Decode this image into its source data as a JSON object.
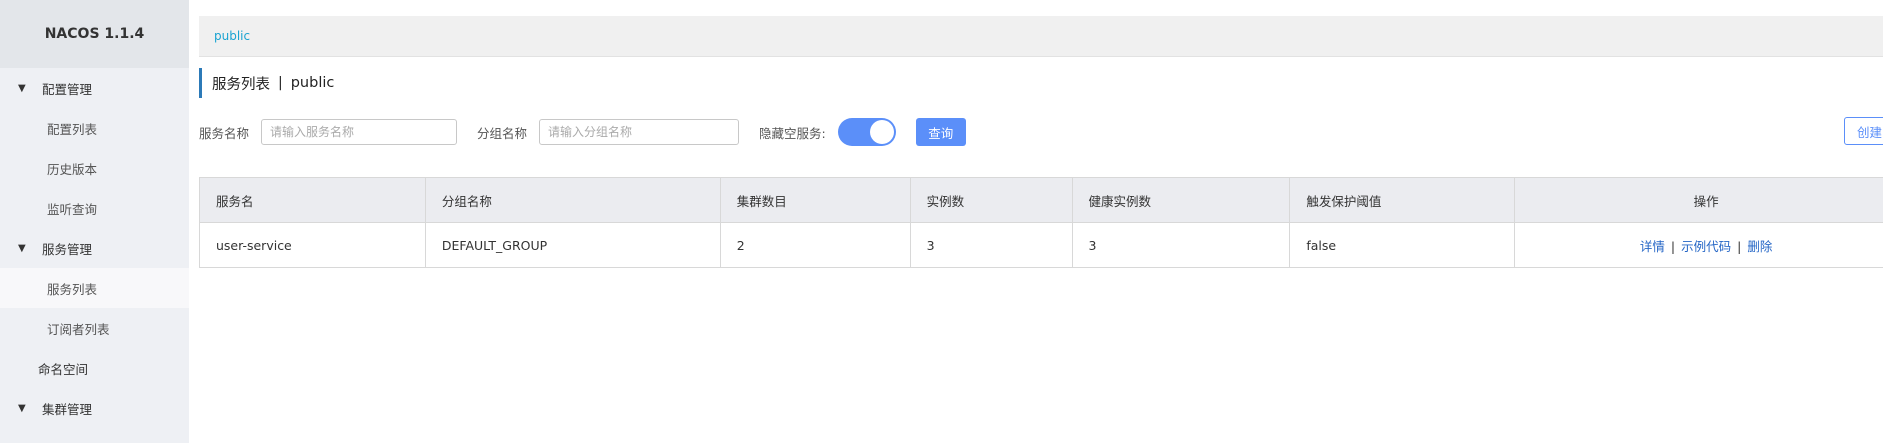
{
  "app": {
    "title": "NACOS 1.1.4"
  },
  "sidebar": {
    "groups": [
      {
        "label": "配置管理",
        "items": [
          "配置列表",
          "历史版本",
          "监听查询"
        ]
      },
      {
        "label": "服务管理",
        "items": [
          "服务列表",
          "订阅者列表"
        ]
      },
      {
        "label": "命名空间"
      },
      {
        "label": "集群管理"
      }
    ],
    "active_item": "服务列表"
  },
  "topbar": {
    "namespace": "public"
  },
  "header": {
    "title": "服务列表",
    "separator": "|",
    "namespace": "public"
  },
  "filters": {
    "service_label": "服务名称",
    "service_placeholder": "请输入服务名称",
    "group_label": "分组名称",
    "group_placeholder": "请输入分组名称",
    "hide_empty_label": "隐藏空服务:",
    "hide_empty_on": true,
    "query_button": "查询",
    "create_button": "创建"
  },
  "table": {
    "headers": [
      "服务名",
      "分组名称",
      "集群数目",
      "实例数",
      "健康实例数",
      "触发保护阈值",
      "操作"
    ],
    "rows": [
      {
        "service": "user-service",
        "group": "DEFAULT_GROUP",
        "clusters": "2",
        "instances": "3",
        "healthy": "3",
        "threshold": "false",
        "actions": [
          "详情",
          "示例代码",
          "删除"
        ]
      }
    ]
  },
  "colors": {
    "accent": "#5b8ff9",
    "link": "#2566c6",
    "namespace_link": "#1aa3d1"
  }
}
